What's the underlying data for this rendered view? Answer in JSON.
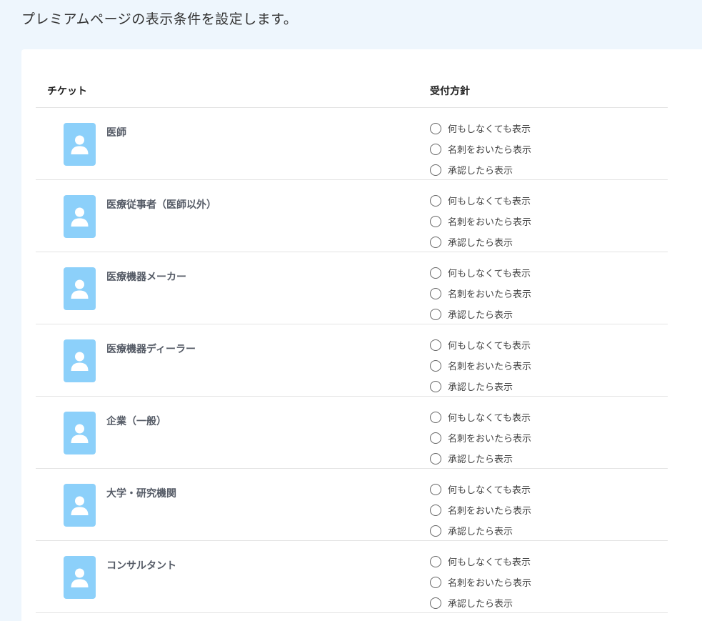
{
  "header": {
    "description": "プレミアムページの表示条件を設定します。"
  },
  "table": {
    "col_ticket": "チケット",
    "col_policy": "受付方針",
    "options": [
      "何もしなくても表示",
      "名刺をおいたら表示",
      "承認したら表示"
    ],
    "rows": [
      {
        "name": "医師"
      },
      {
        "name": "医療従事者（医師以外）"
      },
      {
        "name": "医療機器メーカー"
      },
      {
        "name": "医療機器ディーラー"
      },
      {
        "name": "企業（一般）"
      },
      {
        "name": "大学・研究機関"
      },
      {
        "name": "コンサルタント"
      }
    ]
  },
  "colors": {
    "page_bg": "#eef6fd",
    "avatar_bg": "#8cd0fa",
    "avatar_fg": "#ffffff"
  },
  "icons": {
    "avatar": "person-icon",
    "option": "radio-icon"
  }
}
